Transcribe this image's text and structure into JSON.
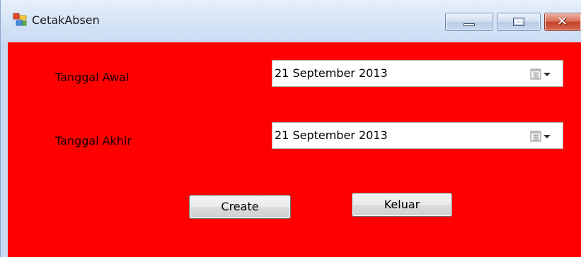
{
  "window": {
    "title": "CetakAbsen",
    "icon": "winforms-app-icon",
    "controls": {
      "minimize_icon": "minimize-icon",
      "maximize_icon": "maximize-icon",
      "close_icon": "close-icon",
      "close_glyph": "✕"
    }
  },
  "form": {
    "background_color": "#ff0000",
    "start_date": {
      "label": "Tanggal Awal",
      "value": "21 September 2013",
      "icon": "calendar-dropdown-icon"
    },
    "end_date": {
      "label": "Tanggal Akhir",
      "value": "21 September 2013",
      "icon": "calendar-dropdown-icon"
    },
    "buttons": {
      "create_label": "Create",
      "exit_label": "Keluar"
    }
  }
}
